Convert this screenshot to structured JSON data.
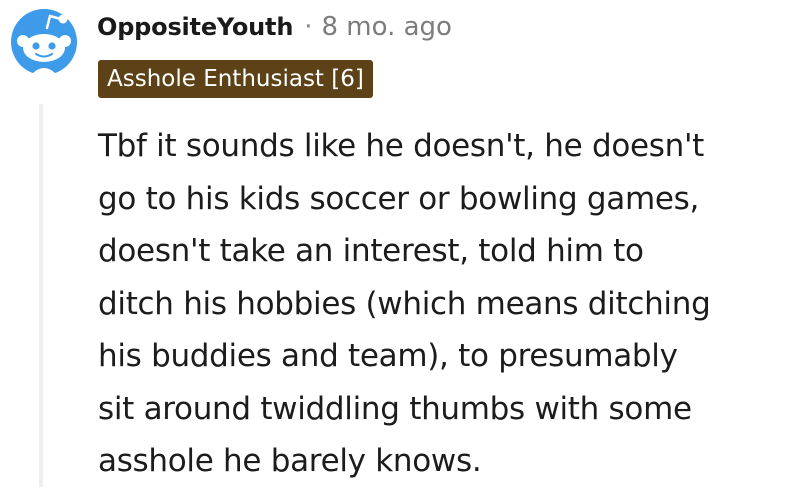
{
  "comment": {
    "author": "OppositeYouth",
    "separator": "·",
    "timestamp": "8 mo. ago",
    "flair": "Asshole Enthusiast [6]",
    "avatar_icon": "snoo-avatar-icon",
    "body_lines": [
      "Tbf it sounds like he doesn't, he doesn't",
      "go to his kids soccer or bowling games,",
      "doesn't take an interest, told him to",
      "ditch his hobbies (which means ditching",
      "his buddies and team), to presumably",
      "sit around twiddling thumbs with some",
      "asshole he barely knows."
    ]
  },
  "colors": {
    "avatar_blue": "#3d9be9",
    "flair_background": "#5c4216",
    "flair_text": "#ffffff",
    "timestamp": "#7c7c7c",
    "thread_line": "#edeff1"
  }
}
